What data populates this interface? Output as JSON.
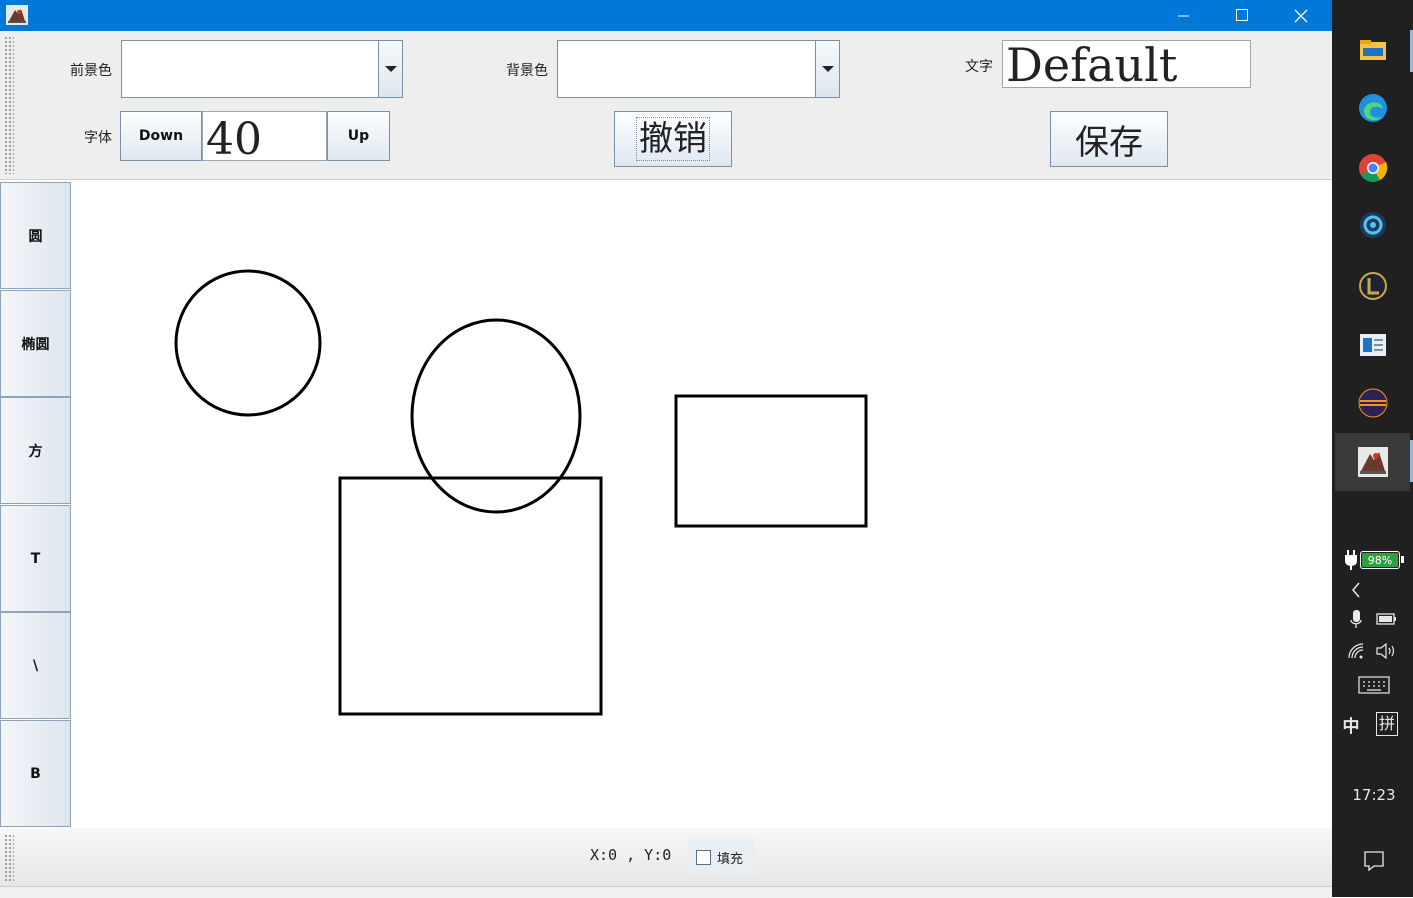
{
  "window": {
    "minimize_glyph": "—",
    "maximize_glyph": "☐",
    "close_glyph": "✕"
  },
  "toolbar": {
    "foreground_label": "前景色",
    "background_label": "背景色",
    "text_label": "文字",
    "text_value": "Default",
    "font_label": "字体",
    "font_down_label": "Down",
    "font_size_value": "40",
    "font_up_label": "Up",
    "undo_label": "撤销",
    "save_label": "保存"
  },
  "tools": [
    {
      "label": "圆"
    },
    {
      "label": "椭圆"
    },
    {
      "label": "方"
    },
    {
      "label": "T"
    },
    {
      "label": "\\"
    },
    {
      "label": "B"
    }
  ],
  "status": {
    "coordinates": "X:0 , Y:0",
    "fill_label": "填充",
    "fill_checked": false
  },
  "taskbar": {
    "battery": "98%",
    "ime_primary": "中",
    "ime_secondary": "拼",
    "time": "17:23",
    "apps": [
      "file-explorer-icon",
      "edge-icon",
      "chrome-icon",
      "app-ring-icon",
      "league-icon",
      "reader-icon",
      "eclipse-icon",
      "java-app-icon"
    ]
  },
  "colors": {
    "title_bar": "#0078d7",
    "taskbar": "#202020",
    "battery_fill": "#2ea043"
  }
}
